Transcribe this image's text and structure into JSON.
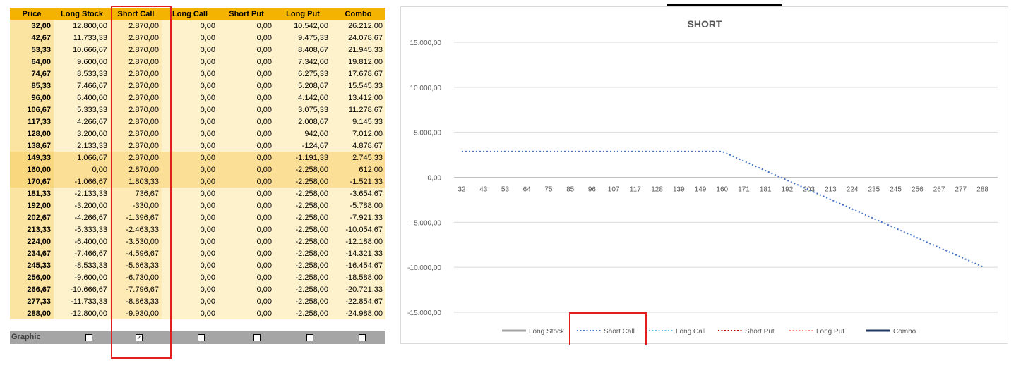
{
  "table": {
    "headers": [
      "Price",
      "Long Stock",
      "Short Call",
      "Long Call",
      "Short Put",
      "Long Put",
      "Combo"
    ],
    "rows": [
      [
        "32,00",
        "12.800,00",
        "2.870,00",
        "0,00",
        "0,00",
        "10.542,00",
        "26.212,00"
      ],
      [
        "42,67",
        "11.733,33",
        "2.870,00",
        "0,00",
        "0,00",
        "9.475,33",
        "24.078,67"
      ],
      [
        "53,33",
        "10.666,67",
        "2.870,00",
        "0,00",
        "0,00",
        "8.408,67",
        "21.945,33"
      ],
      [
        "64,00",
        "9.600,00",
        "2.870,00",
        "0,00",
        "0,00",
        "7.342,00",
        "19.812,00"
      ],
      [
        "74,67",
        "8.533,33",
        "2.870,00",
        "0,00",
        "0,00",
        "6.275,33",
        "17.678,67"
      ],
      [
        "85,33",
        "7.466,67",
        "2.870,00",
        "0,00",
        "0,00",
        "5.208,67",
        "15.545,33"
      ],
      [
        "96,00",
        "6.400,00",
        "2.870,00",
        "0,00",
        "0,00",
        "4.142,00",
        "13.412,00"
      ],
      [
        "106,67",
        "5.333,33",
        "2.870,00",
        "0,00",
        "0,00",
        "3.075,33",
        "11.278,67"
      ],
      [
        "117,33",
        "4.266,67",
        "2.870,00",
        "0,00",
        "0,00",
        "2.008,67",
        "9.145,33"
      ],
      [
        "128,00",
        "3.200,00",
        "2.870,00",
        "0,00",
        "0,00",
        "942,00",
        "7.012,00"
      ],
      [
        "138,67",
        "2.133,33",
        "2.870,00",
        "0,00",
        "0,00",
        "-124,67",
        "4.878,67"
      ],
      [
        "149,33",
        "1.066,67",
        "2.870,00",
        "0,00",
        "0,00",
        "-1.191,33",
        "2.745,33"
      ],
      [
        "160,00",
        "0,00",
        "2.870,00",
        "0,00",
        "0,00",
        "-2.258,00",
        "612,00"
      ],
      [
        "170,67",
        "-1.066,67",
        "1.803,33",
        "0,00",
        "0,00",
        "-2.258,00",
        "-1.521,33"
      ],
      [
        "181,33",
        "-2.133,33",
        "736,67",
        "0,00",
        "0,00",
        "-2.258,00",
        "-3.654,67"
      ],
      [
        "192,00",
        "-3.200,00",
        "-330,00",
        "0,00",
        "0,00",
        "-2.258,00",
        "-5.788,00"
      ],
      [
        "202,67",
        "-4.266,67",
        "-1.396,67",
        "0,00",
        "0,00",
        "-2.258,00",
        "-7.921,33"
      ],
      [
        "213,33",
        "-5.333,33",
        "-2.463,33",
        "0,00",
        "0,00",
        "-2.258,00",
        "-10.054,67"
      ],
      [
        "224,00",
        "-6.400,00",
        "-3.530,00",
        "0,00",
        "0,00",
        "-2.258,00",
        "-12.188,00"
      ],
      [
        "234,67",
        "-7.466,67",
        "-4.596,67",
        "0,00",
        "0,00",
        "-2.258,00",
        "-14.321,33"
      ],
      [
        "245,33",
        "-8.533,33",
        "-5.663,33",
        "0,00",
        "0,00",
        "-2.258,00",
        "-16.454,67"
      ],
      [
        "256,00",
        "-9.600,00",
        "-6.730,00",
        "0,00",
        "0,00",
        "-2.258,00",
        "-18.588,00"
      ],
      [
        "266,67",
        "-10.666,67",
        "-7.796,67",
        "0,00",
        "0,00",
        "-2.258,00",
        "-20.721,33"
      ],
      [
        "277,33",
        "-11.733,33",
        "-8.863,33",
        "0,00",
        "0,00",
        "-2.258,00",
        "-22.854,67"
      ],
      [
        "288,00",
        "-12.800,00",
        "-9.930,00",
        "0,00",
        "0,00",
        "-2.258,00",
        "-24.988,00"
      ]
    ],
    "banded_rows": [
      11,
      12,
      13
    ],
    "highlighted_column": 2
  },
  "graphic": {
    "label": "Graphic",
    "checkboxes": [
      {
        "series": "Long Stock",
        "checked": false
      },
      {
        "series": "Short Call",
        "checked": true
      },
      {
        "series": "Long Call",
        "checked": false
      },
      {
        "series": "Short Put",
        "checked": false
      },
      {
        "series": "Long Put",
        "checked": false
      },
      {
        "series": "Combo",
        "checked": false
      }
    ],
    "check_mark": "✓"
  },
  "chart_data": {
    "type": "line",
    "title": "SHORT",
    "xlabel": "",
    "ylabel": "",
    "categories": [
      "32",
      "43",
      "53",
      "64",
      "75",
      "85",
      "96",
      "107",
      "117",
      "128",
      "139",
      "149",
      "160",
      "171",
      "181",
      "192",
      "203",
      "213",
      "224",
      "235",
      "245",
      "256",
      "267",
      "277",
      "288"
    ],
    "y_ticks": [
      15000,
      10000,
      5000,
      0,
      -5000,
      -10000,
      -15000
    ],
    "y_tick_labels": [
      "15.000,00",
      "10.000,00",
      "5.000,00",
      "0,00",
      "-5.000,00",
      "-10.000,00",
      "-15.000,00"
    ],
    "ylim": [
      -15000,
      15000
    ],
    "grid": true,
    "legend_position": "bottom",
    "series": [
      {
        "name": "Long Stock",
        "color": "#a5a5a5",
        "style": "solid",
        "visible": false
      },
      {
        "name": "Short Call",
        "color": "#4472c4",
        "style": "dotted",
        "visible": true,
        "values": [
          2870,
          2870,
          2870,
          2870,
          2870,
          2870,
          2870,
          2870,
          2870,
          2870,
          2870,
          2870,
          2870,
          1803.33,
          736.67,
          -330,
          -1396.67,
          -2463.33,
          -3530,
          -4596.67,
          -5663.33,
          -6730,
          -7796.67,
          -8863.33,
          -9930
        ]
      },
      {
        "name": "Long Call",
        "color": "#5bc0de",
        "style": "dotted",
        "visible": false
      },
      {
        "name": "Short Put",
        "color": "#c00000",
        "style": "dotted",
        "visible": false
      },
      {
        "name": "Long Put",
        "color": "#ff8080",
        "style": "dotted",
        "visible": false
      },
      {
        "name": "Combo",
        "color": "#203864",
        "style": "solid",
        "visible": false
      }
    ]
  }
}
